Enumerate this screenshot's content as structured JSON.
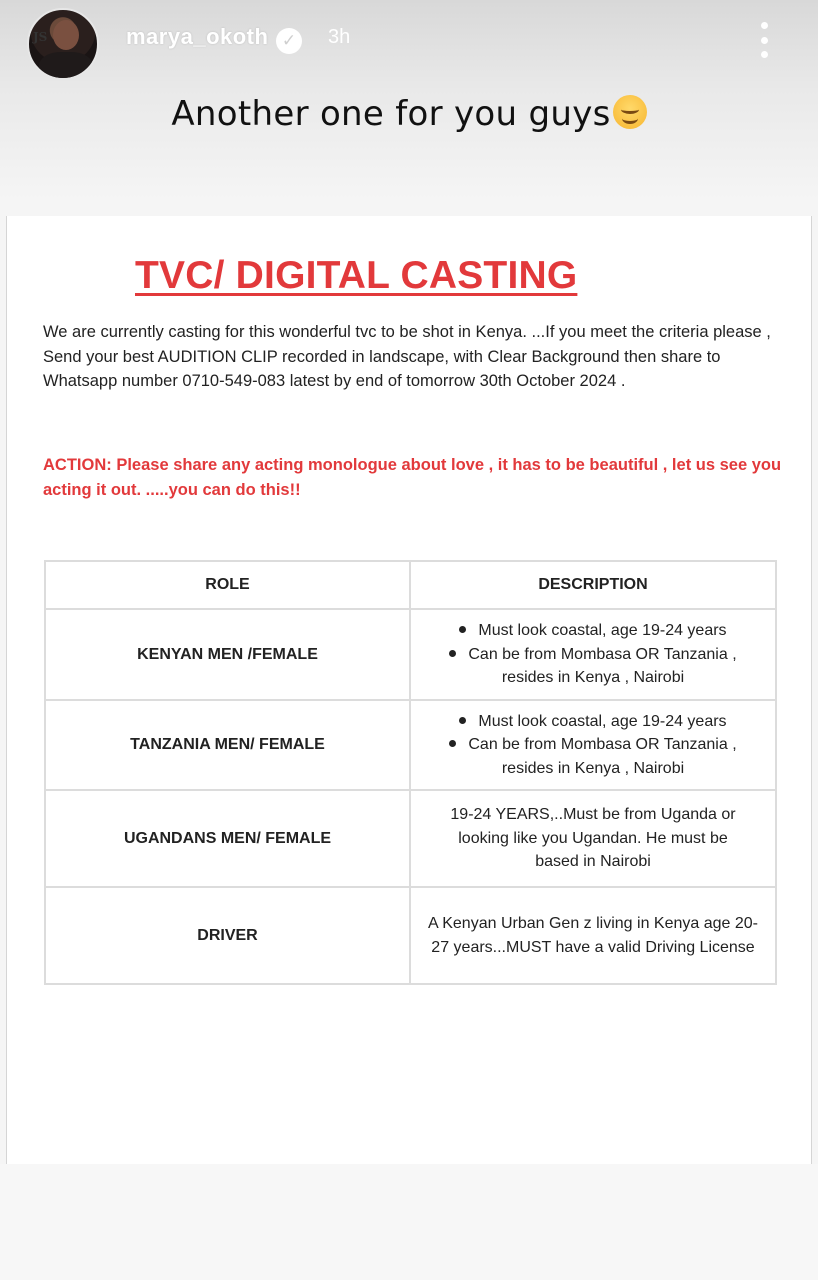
{
  "story": {
    "username": "marya_okoth",
    "time": "3h",
    "caption": "Another one for you guys",
    "avatar_badge": "JS"
  },
  "document": {
    "title": "TVC/ DIGITAL CASTING",
    "intro": "We are currently casting for this wonderful tvc to be shot in Kenya. ...If you meet the criteria please , Send your  best AUDITION CLIP recorded in landscape, with Clear Background then share to Whatsapp number 0710-549-083 latest by end of tomorrow 30th October 2024 .",
    "action": "ACTION: Please share any acting monologue about love , it has to be beautiful , let us see you acting it out. .....you can do this!!",
    "table": {
      "headers": [
        "ROLE",
        "DESCRIPTION"
      ],
      "rows": [
        {
          "role": "KENYAN MEN /FEMALE",
          "bullets": [
            "Must look coastal, age 19-24 years",
            "Can be from Mombasa OR Tanzania ,",
            "resides in Kenya , Nairobi"
          ]
        },
        {
          "role": "TANZANIA MEN/ FEMALE",
          "bullets": [
            "Must look coastal, age 19-24 years",
            "Can be from Mombasa OR Tanzania ,",
            "resides in Kenya , Nairobi"
          ]
        },
        {
          "role": "UGANDANS MEN/ FEMALE",
          "description": "19-24 YEARS,..Must be from Uganda or looking like you Ugandan.  He must be based in Nairobi"
        },
        {
          "role": "DRIVER",
          "description": "A Kenyan Urban Gen z living in Kenya age 20-27 years...MUST have a valid Driving License"
        }
      ]
    }
  },
  "colors": {
    "accent_red": "#e2393b",
    "text": "#222222"
  }
}
